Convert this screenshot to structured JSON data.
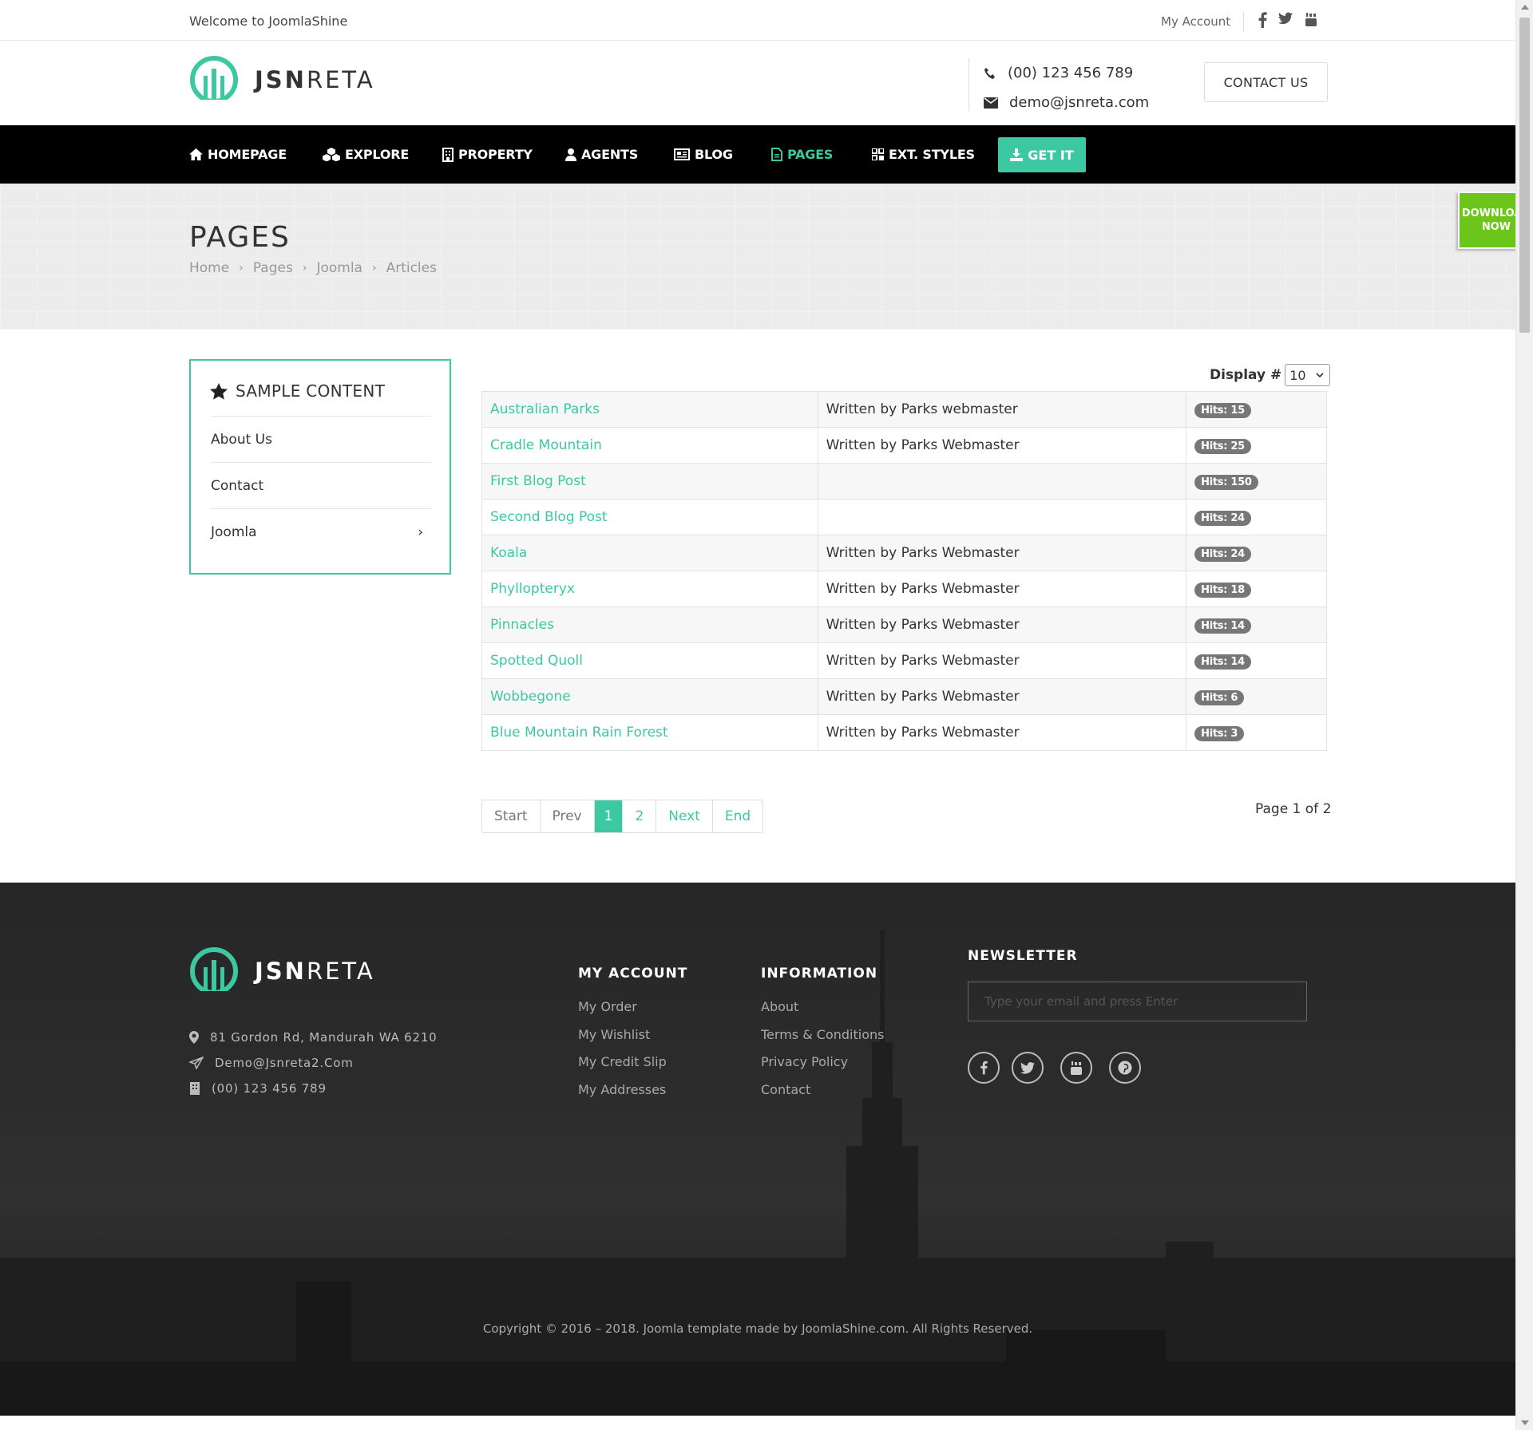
{
  "topbar": {
    "welcome": "Welcome to JoomlaShine",
    "account_link": "My Account",
    "social_icons": [
      "facebook-icon",
      "twitter-icon",
      "youtube-icon"
    ]
  },
  "header": {
    "brand_bold": "JSN",
    "brand_light": "RETA",
    "phone": "(00) 123 456 789",
    "email": "demo@jsnreta.com",
    "contact_button": "CONTACT US"
  },
  "nav": {
    "items": [
      {
        "label": "HOMEPAGE",
        "icon": "home-icon"
      },
      {
        "label": "EXPLORE",
        "icon": "cubes-icon"
      },
      {
        "label": "PROPERTY",
        "icon": "building-icon"
      },
      {
        "label": "AGENTS",
        "icon": "user-icon"
      },
      {
        "label": "BLOG",
        "icon": "newspaper-icon"
      },
      {
        "label": "PAGES",
        "icon": "file-icon",
        "active": true
      },
      {
        "label": "EXT. STYLES",
        "icon": "grid-icon"
      }
    ],
    "get_it": "GET IT",
    "accent": "#3cc8a0"
  },
  "banner": {
    "title": "PAGES",
    "breadcrumb": [
      "Home",
      "Pages",
      "Joomla",
      "Articles"
    ]
  },
  "download_tab": {
    "line1": "DOWNLOAD",
    "line2": "NOW",
    "color": "#6bc51a"
  },
  "sidebar": {
    "title": "SAMPLE CONTENT",
    "items": [
      {
        "label": "About Us"
      },
      {
        "label": "Contact"
      },
      {
        "label": "Joomla",
        "has_children": true
      }
    ]
  },
  "list": {
    "display_label": "Display #",
    "display_value": "10",
    "rows": [
      {
        "title": "Australian Parks",
        "author": "Written by Parks webmaster",
        "hits": "Hits: 15"
      },
      {
        "title": "Cradle Mountain",
        "author": "Written by Parks Webmaster",
        "hits": "Hits: 25"
      },
      {
        "title": "First Blog Post",
        "author": "",
        "hits": "Hits: 150"
      },
      {
        "title": "Second Blog Post",
        "author": "",
        "hits": "Hits: 24"
      },
      {
        "title": "Koala",
        "author": "Written by Parks Webmaster",
        "hits": "Hits: 24"
      },
      {
        "title": "Phyllopteryx",
        "author": "Written by Parks Webmaster",
        "hits": "Hits: 18"
      },
      {
        "title": "Pinnacles",
        "author": "Written by Parks Webmaster",
        "hits": "Hits: 14"
      },
      {
        "title": "Spotted Quoll",
        "author": "Written by Parks Webmaster",
        "hits": "Hits: 14"
      },
      {
        "title": "Wobbegone",
        "author": "Written by Parks Webmaster",
        "hits": "Hits: 6"
      },
      {
        "title": "Blue Mountain Rain Forest",
        "author": "Written by Parks Webmaster",
        "hits": "Hits: 3"
      }
    ]
  },
  "pagination": {
    "start": "Start",
    "prev": "Prev",
    "pages": [
      "1",
      "2"
    ],
    "current": "1",
    "next": "Next",
    "end": "End",
    "counter": "Page 1 of 2"
  },
  "footer": {
    "brand_bold": "JSN",
    "brand_light": "RETA",
    "address": "81 Gordon Rd, Mandurah WA 6210",
    "email": "Demo@Jsnreta2.Com",
    "phone": "(00) 123 456 789",
    "my_account": {
      "title": "MY ACCOUNT",
      "links": [
        "My Order",
        "My Wishlist",
        "My Credit Slip",
        "My Addresses"
      ]
    },
    "information": {
      "title": "INFORMATION",
      "links": [
        "About",
        "Terms & Conditions",
        "Privacy Policy",
        "Contact"
      ]
    },
    "newsletter": {
      "title": "NEWSLETTER",
      "placeholder": "Type your email and press Enter"
    },
    "social_icons": [
      "facebook-icon",
      "twitter-icon",
      "youtube-icon",
      "pinterest-icon"
    ],
    "copyright": "Copyright © 2016 – 2018. Joomla template made by JoomlaShine.com. All Rights Reserved."
  }
}
